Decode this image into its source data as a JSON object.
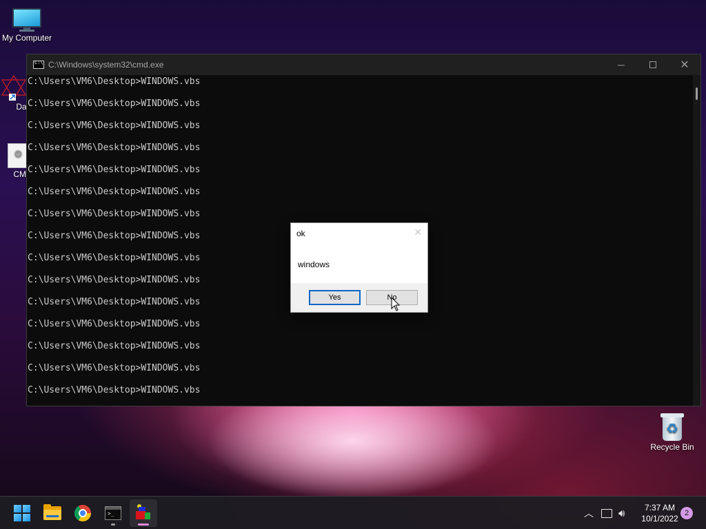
{
  "desktop": {
    "icons": [
      {
        "label": "My Computer"
      },
      {
        "label": "DataW"
      },
      {
        "label": "CMD"
      },
      {
        "label": "Recycle Bin"
      }
    ]
  },
  "cmd_window": {
    "title": "C:\\Windows\\system32\\cmd.exe",
    "lines": [
      "C:\\Users\\VM6\\Desktop>WINDOWS.vbs",
      "C:\\Users\\VM6\\Desktop>WINDOWS.vbs",
      "C:\\Users\\VM6\\Desktop>WINDOWS.vbs",
      "C:\\Users\\VM6\\Desktop>WINDOWS.vbs",
      "C:\\Users\\VM6\\Desktop>WINDOWS.vbs",
      "C:\\Users\\VM6\\Desktop>WINDOWS.vbs",
      "C:\\Users\\VM6\\Desktop>WINDOWS.vbs",
      "C:\\Users\\VM6\\Desktop>WINDOWS.vbs",
      "C:\\Users\\VM6\\Desktop>WINDOWS.vbs",
      "C:\\Users\\VM6\\Desktop>WINDOWS.vbs",
      "C:\\Users\\VM6\\Desktop>WINDOWS.vbs",
      "C:\\Users\\VM6\\Desktop>WINDOWS.vbs",
      "C:\\Users\\VM6\\Desktop>WINDOWS.vbs",
      "C:\\Users\\VM6\\Desktop>WINDOWS.vbs",
      "C:\\Users\\VM6\\Desktop>WINDOWS.vbs"
    ]
  },
  "msgbox": {
    "title": "ok",
    "message": "windows",
    "yes_label": "Yes",
    "no_label": "No"
  },
  "taskbar": {
    "items": [
      {
        "icon": "windows-start-icon"
      },
      {
        "icon": "file-explorer-icon"
      },
      {
        "icon": "chrome-icon"
      },
      {
        "icon": "terminal-icon"
      },
      {
        "icon": "vbs-script-icon"
      }
    ],
    "tray": {
      "time": "7:37 AM",
      "date": "10/1/2022",
      "notification_count": "2"
    }
  },
  "colors": {
    "accent": "#0a64c8",
    "console_text": "#cccccc",
    "console_bg": "#0c0c0c"
  }
}
